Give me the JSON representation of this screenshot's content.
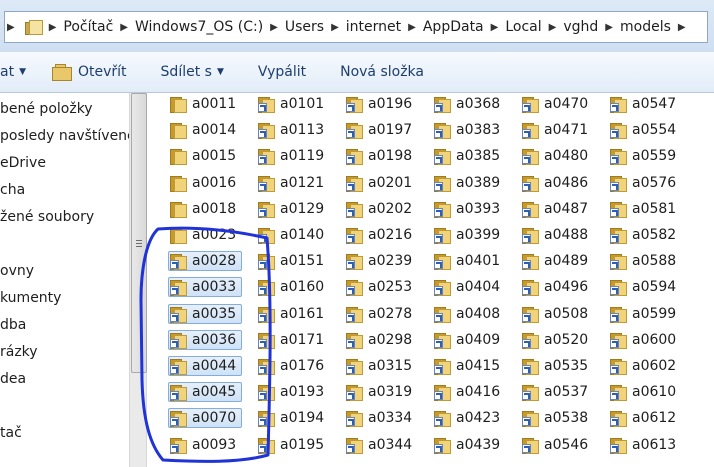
{
  "address": {
    "crumbs": [
      "Počítač",
      "Windows7_OS (C:)",
      "Users",
      "internet",
      "AppData",
      "Local",
      "vghd",
      "models"
    ]
  },
  "toolbar": {
    "organize": "at",
    "open": "Otevřít",
    "share": "Sdílet s",
    "burn": "Vypálit",
    "new_folder": "Nová složka"
  },
  "sidebar": {
    "items": [
      "bené položky",
      "posledy navštívené",
      "eDrive",
      "cha",
      "žené soubory",
      "ovny",
      "kumenty",
      "dba",
      "rázky",
      "dea",
      "tač"
    ]
  },
  "files": {
    "columns": [
      [
        "a0011",
        "a0014",
        "a0015",
        "a0016",
        "a0018",
        "a0023",
        "a0028",
        "a0033",
        "a0035",
        "a0036",
        "a0044",
        "a0045",
        "a0070",
        "a0093"
      ],
      [
        "a0101",
        "a0113",
        "a0119",
        "a0121",
        "a0129",
        "a0140",
        "a0151",
        "a0160",
        "a0161",
        "a0171",
        "a0176",
        "a0193",
        "a0194",
        "a0195"
      ],
      [
        "a0196",
        "a0197",
        "a0198",
        "a0201",
        "a0202",
        "a0216",
        "a0239",
        "a0253",
        "a0278",
        "a0298",
        "a0315",
        "a0319",
        "a0334",
        "a0344"
      ],
      [
        "a0368",
        "a0383",
        "a0385",
        "a0389",
        "a0393",
        "a0399",
        "a0401",
        "a0404",
        "a0408",
        "a0409",
        "a0415",
        "a0416",
        "a0423",
        "a0439"
      ],
      [
        "a0470",
        "a0471",
        "a0480",
        "a0486",
        "a0487",
        "a0488",
        "a0489",
        "a0496",
        "a0508",
        "a0520",
        "a0535",
        "a0537",
        "a0538",
        "a0546"
      ],
      [
        "a0547",
        "a0554",
        "a0559",
        "a0576",
        "a0581",
        "a0582",
        "a0588",
        "a0594",
        "a0599",
        "a0600",
        "a0602",
        "a0610",
        "a0612",
        "a0613"
      ]
    ],
    "shortcut_in_first_column_from": 6,
    "selected_in_first_column": [
      "a0028",
      "a0033",
      "a0035",
      "a0036",
      "a0044",
      "a0045",
      "a0070"
    ]
  },
  "annotation": {
    "color": "#1f33d6"
  }
}
